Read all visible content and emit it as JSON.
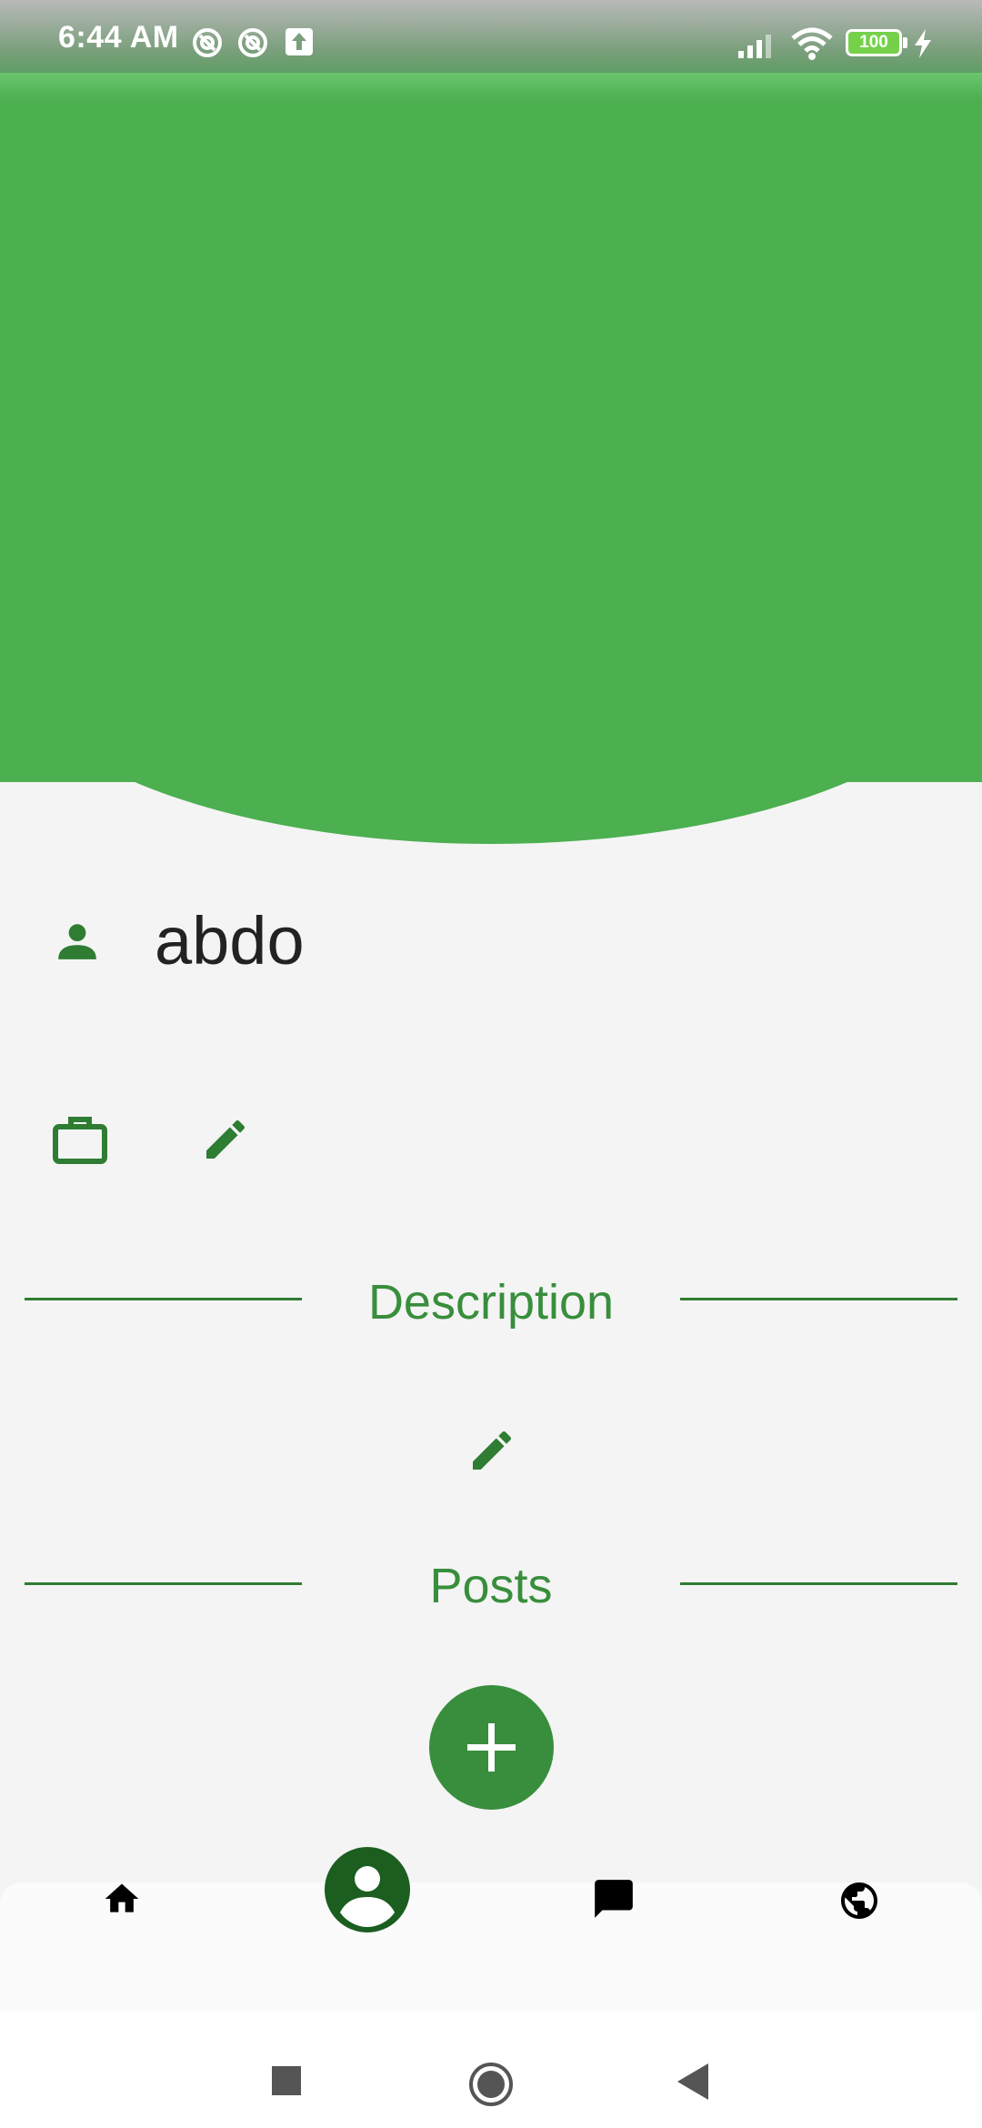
{
  "status_bar": {
    "time": "6:44 AM",
    "battery": "100",
    "icons": [
      "sync-icon",
      "sync-icon",
      "upload-icon",
      "signal-icon",
      "wifi-icon",
      "battery-icon",
      "charging-icon"
    ]
  },
  "colors": {
    "header": "#4caf50",
    "accent": "#388e3c",
    "dark_accent": "#1b5e20",
    "background": "#f4f4f4"
  },
  "profile": {
    "name": "abdo"
  },
  "sections": {
    "description_title": "Description",
    "posts_title": "Posts"
  },
  "bottom_nav": {
    "items": [
      "home-icon",
      "profile-icon",
      "chat-icon",
      "globe-icon"
    ],
    "active": "profile-icon"
  },
  "system_nav": {
    "buttons": [
      "recents-button",
      "home-button",
      "back-button"
    ]
  }
}
